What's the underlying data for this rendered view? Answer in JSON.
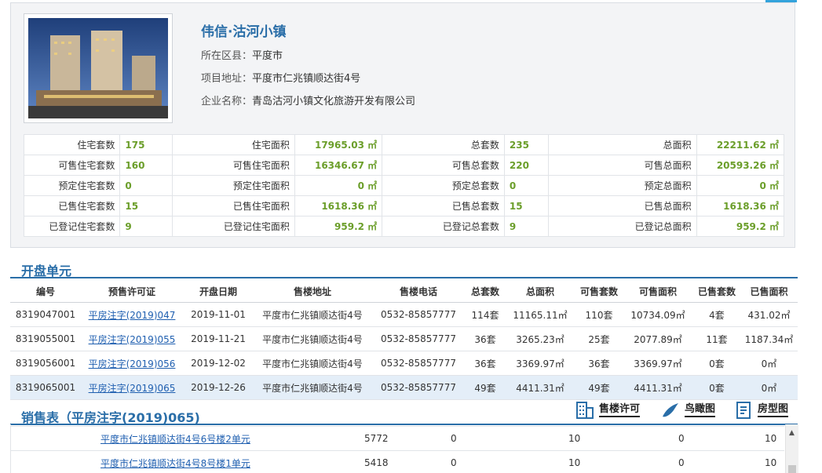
{
  "project": {
    "title": "伟信·沽河小镇",
    "district_label": "所在区县：",
    "district": "平度市",
    "address_label": "项目地址：",
    "address": "平度市仁兆镇顺达街4号",
    "company_label": "企业名称：",
    "company": "青岛沽河小镇文化旅游开发有限公司"
  },
  "stats": [
    [
      "住宅套数",
      "175",
      "住宅面积",
      "17965.03 ㎡",
      "总套数",
      "235",
      "总面积",
      "22211.62 ㎡"
    ],
    [
      "可售住宅套数",
      "160",
      "可售住宅面积",
      "16346.67 ㎡",
      "可售总套数",
      "220",
      "可售总面积",
      "20593.26 ㎡"
    ],
    [
      "预定住宅套数",
      "0",
      "预定住宅面积",
      "0 ㎡",
      "预定总套数",
      "0",
      "预定总面积",
      "0 ㎡"
    ],
    [
      "已售住宅套数",
      "15",
      "已售住宅面积",
      "1618.36 ㎡",
      "已售总套数",
      "15",
      "已售总面积",
      "1618.36 ㎡"
    ],
    [
      "已登记住宅套数",
      "9",
      "已登记住宅面积",
      "959.2 ㎡",
      "已登记总套数",
      "9",
      "已登记总面积",
      "959.2 ㎡"
    ]
  ],
  "units_section": {
    "title": "开盘单元"
  },
  "units_table": {
    "headers": [
      "编号",
      "预售许可证",
      "开盘日期",
      "售楼地址",
      "售楼电话",
      "总套数",
      "总面积",
      "可售套数",
      "可售面积",
      "已售套数",
      "已售面积"
    ],
    "rows": [
      [
        "8319047001",
        "平房注字(2019)047",
        "2019-11-01",
        "平度市仁兆镇顺达街4号",
        "0532-85857777",
        "114套",
        "11165.11㎡",
        "110套",
        "10734.09㎡",
        "4套",
        "431.02㎡"
      ],
      [
        "8319055001",
        "平房注字(2019)055",
        "2019-11-21",
        "平度市仁兆镇顺达街4号",
        "0532-85857777",
        "36套",
        "3265.23㎡",
        "25套",
        "2077.89㎡",
        "11套",
        "1187.34㎡"
      ],
      [
        "8319056001",
        "平房注字(2019)056",
        "2019-12-02",
        "平度市仁兆镇顺达街4号",
        "0532-85857777",
        "36套",
        "3369.97㎡",
        "36套",
        "3369.97㎡",
        "0套",
        "0㎡"
      ],
      [
        "8319065001",
        "平房注字(2019)065",
        "2019-12-26",
        "平度市仁兆镇顺达街4号",
        "0532-85857777",
        "49套",
        "4411.31㎡",
        "49套",
        "4411.31㎡",
        "0套",
        "0㎡"
      ]
    ]
  },
  "sales_section": {
    "title": "销售表（平房注字(2019)065)"
  },
  "tools": {
    "permit": "售楼许可",
    "aerial": "鸟瞰图",
    "floorplan": "房型图"
  },
  "sales_rows": [
    [
      "平度市仁兆镇顺达街4号6号楼2单元",
      "5772",
      "0",
      "10",
      "0",
      "10"
    ],
    [
      "平度市仁兆镇顺达街4号8号楼1单元",
      "5418",
      "0",
      "10",
      "0",
      "10"
    ]
  ],
  "colors": {
    "accent": "#2a6ea8",
    "value_green": "#6b9e2a",
    "link": "#1f5fb0",
    "selected_row": "#e4eef8"
  }
}
